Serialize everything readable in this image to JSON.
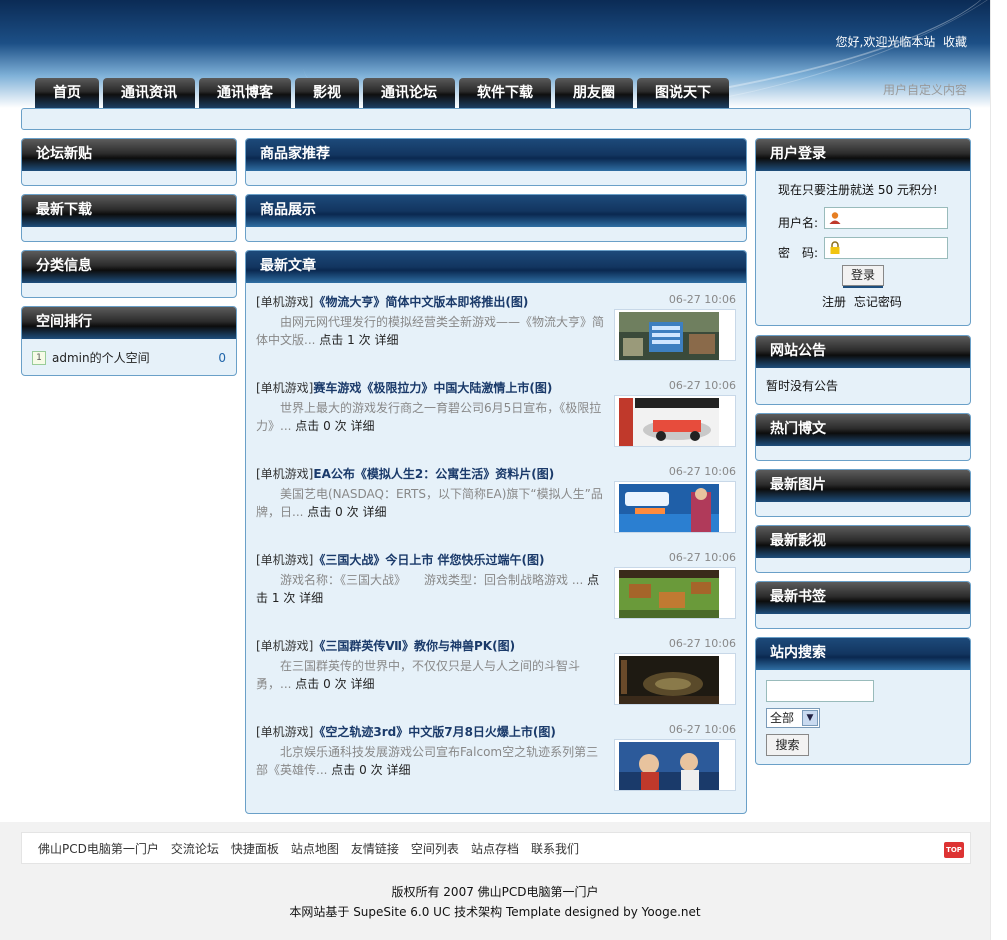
{
  "header": {
    "welcome": "您好,欢迎光临本站",
    "bookmark": "收藏",
    "custom_content": "用户自定义内容"
  },
  "nav": [
    "首页",
    "通讯资讯",
    "通讯博客",
    "影视",
    "通讯论坛",
    "软件下载",
    "朋友圈",
    "图说天下"
  ],
  "left": {
    "forum_new": "论坛新贴",
    "new_download": "最新下载",
    "category_info": "分类信息",
    "space_rank": "空间排行",
    "rank_items": [
      {
        "num": "1",
        "name": "admin的个人空间",
        "count": "0"
      }
    ]
  },
  "center": {
    "merchant": "商品家推荐",
    "goods": "商品展示",
    "latest": "最新文章",
    "articles": [
      {
        "cat": "[单机游戏]",
        "title": "《物流大亨》简体中文版本即将推出(图)",
        "date": "06-27 10:06",
        "summary": "由网元网代理发行的模拟经营类全新游戏——《物流大亨》简体中文版...",
        "clicks_label": "点击",
        "clicks": "1",
        "unit": "次",
        "detail": "详细"
      },
      {
        "cat": "[单机游戏]",
        "title": "赛车游戏《极限拉力》中国大陆激情上市(图)",
        "date": "06-27 10:06",
        "summary": "世界上最大的游戏发行商之一育碧公司6月5日宣布，《极限拉力》...",
        "clicks_label": "点击",
        "clicks": "0",
        "unit": "次",
        "detail": "详细"
      },
      {
        "cat": "[单机游戏]",
        "title": "EA公布《模拟人生2：公寓生活》资料片(图)",
        "date": "06-27 10:06",
        "summary": "美国艺电(NASDAQ：ERTS，以下简称EA)旗下“模拟人生”品牌，日...",
        "clicks_label": "点击",
        "clicks": "0",
        "unit": "次",
        "detail": "详细"
      },
      {
        "cat": "[单机游戏]",
        "title": "《三国大战》今日上市 伴您快乐过端午(图)",
        "date": "06-27 10:06",
        "summary": "游戏名称：《三国大战》　　游戏类型：回合制战略游戏 ...",
        "clicks_label": "点击",
        "clicks": "1",
        "unit": "次",
        "detail": "详细"
      },
      {
        "cat": "[单机游戏]",
        "title": "《三国群英传Ⅶ》教你与神兽PK(图)",
        "date": "06-27 10:06",
        "summary": "在三国群英传的世界中，不仅仅只是人与人之间的斗智斗勇，...",
        "clicks_label": "点击",
        "clicks": "0",
        "unit": "次",
        "detail": "详细"
      },
      {
        "cat": "[单机游戏]",
        "title": "《空之轨迹3rd》中文版7月8日火爆上市(图)",
        "date": "06-27 10:06",
        "summary": "北京娱乐通科技发展游戏公司宣布Falcom空之轨迹系列第三部《英雄传...",
        "clicks_label": "点击",
        "clicks": "0",
        "unit": "次",
        "detail": "详细"
      }
    ]
  },
  "right": {
    "login_title": "用户登录",
    "login_note": "现在只要注册就送 50 元积分!",
    "username_label": "用户名:",
    "password_label": "密　码:",
    "login_button": "登录",
    "register": "注册",
    "forgot": "忘记密码",
    "notice_title": "网站公告",
    "notice_text": "暂时没有公告",
    "hot_blog": "热门博文",
    "new_pics": "最新图片",
    "new_video": "最新影视",
    "new_bookmark": "最新书签",
    "search_title": "站内搜索",
    "search_select": "全部",
    "search_button": "搜索"
  },
  "footer": {
    "links": [
      "佛山PCD电脑第一门户",
      "交流论坛",
      "快捷面板",
      "站点地图",
      "友情链接",
      "空间列表",
      "站点存档",
      "联系我们"
    ],
    "top": "TOP",
    "copyright": "版权所有 2007 佛山PCD电脑第一门户",
    "powered": "本网站基于 SupeSite 6.0 UC 技术架构 Template designed by Yooge.net"
  }
}
